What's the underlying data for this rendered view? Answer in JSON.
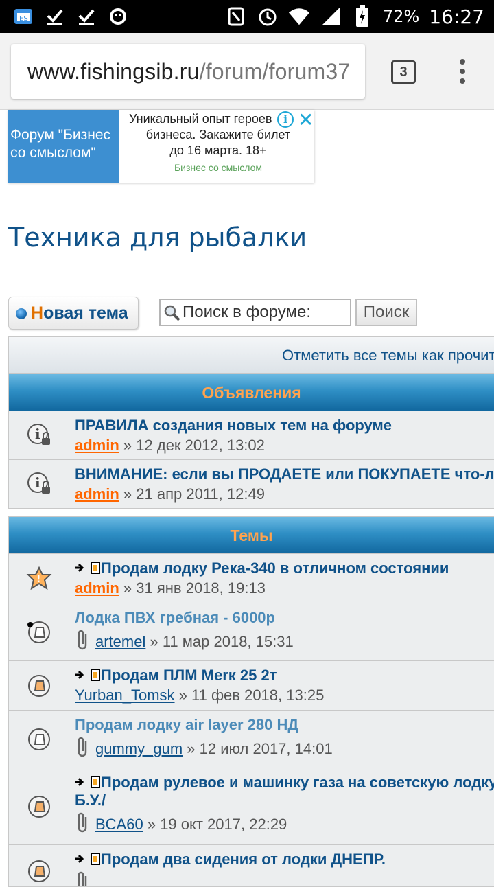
{
  "status_bar": {
    "icons_left": [
      "app-icon",
      "check-icon",
      "check-icon",
      "shield-icon"
    ],
    "icons_right": [
      "nfc-icon",
      "alarm-icon",
      "wifi-icon",
      "signal-icon",
      "battery-charging-icon"
    ],
    "battery": "72%",
    "time": "16:27"
  },
  "browser": {
    "url_domain": "www.fishingsib.ru",
    "url_path": "/forum/forum37",
    "tab_count": "3"
  },
  "ad": {
    "left_text_line1": "Форум \"Бизнес",
    "left_text_line2": "со смыслом\"",
    "text_line1": "Уникальный опыт героев",
    "text_line2": "бизнеса. Закажите билет",
    "text_line3": "до 16 марта. 18+",
    "source": "Бизнес со смыслом",
    "info_label": "i",
    "close_label": "✕"
  },
  "page": {
    "title": "Техника для рыбалки",
    "new_topic_first": "Н",
    "new_topic_rest": "овая тема",
    "search_placeholder": "Поиск в форуме:",
    "search_button": "Поиск",
    "mark_all": "Отметить все темы как прочитанные"
  },
  "sections": {
    "announcements": {
      "title": "Объявления",
      "rows": [
        {
          "title": "ПРАВИЛА создания новых тем на форуме",
          "author": "admin",
          "date": "» 12 дек 2012, 13:02"
        },
        {
          "title": "ВНИМАНИЕ: если вы ПРОДАЕТЕ или ПОКУПАЕТЕ что-либо",
          "author": "admin",
          "date": "» 21 апр 2011, 12:49"
        }
      ]
    },
    "topics": {
      "title": "Темы",
      "rows": [
        {
          "title": "Продам лодку Река-340 в отличном состоянии",
          "author": "admin",
          "date": "» 31 янв 2018, 19:13"
        },
        {
          "title": "Лодка ПВХ гребная - 6000р",
          "author": "artemel",
          "date": "» 11 мар 2018, 15:31"
        },
        {
          "title": "Продам ПЛМ Merк 25 2т",
          "author": "Yurban_Tomsk",
          "date": "» 11 фев 2018, 13:25"
        },
        {
          "title": "Продам лодку air layer 280 НД",
          "author": "gummy_gum",
          "date": "» 12 июл 2017, 14:01"
        },
        {
          "title_line1": "Продам рулевое и машинку газа на советскую лодку",
          "title_line2": "Б.У./",
          "author": "BCA60",
          "date": "» 19 окт 2017, 22:29"
        },
        {
          "title": "Продам два сидения от лодки ДНЕПР."
        }
      ]
    }
  }
}
